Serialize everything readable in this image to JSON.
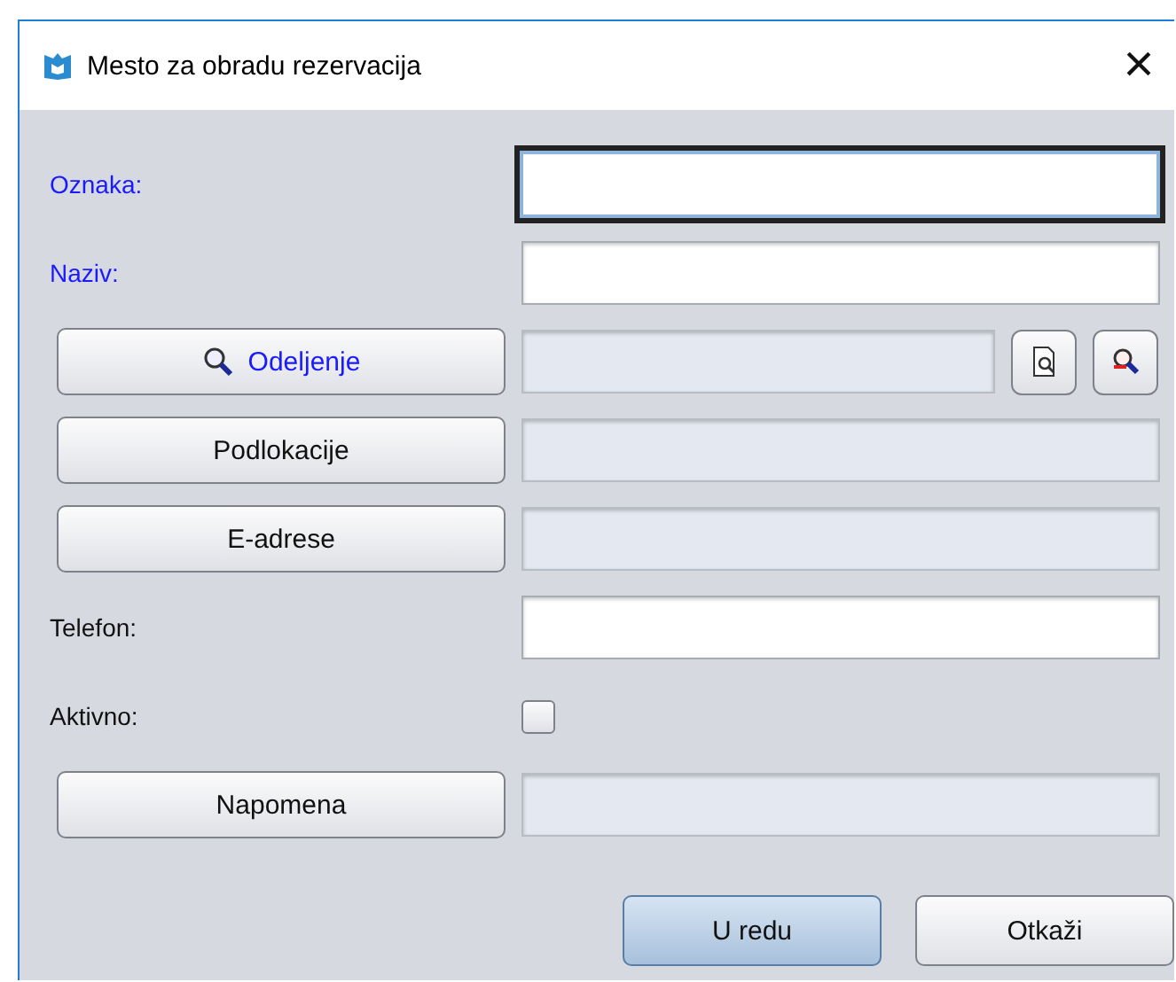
{
  "window": {
    "title": "Mesto za obradu rezervacija",
    "close": "×"
  },
  "rows": [
    {
      "kind": "text",
      "label": "Oznaka:",
      "required": true,
      "editable": true,
      "focused": true
    },
    {
      "kind": "text",
      "label": "Naziv:",
      "required": true,
      "editable": true,
      "focused": false
    },
    {
      "kind": "lookup",
      "label": "Odeljenje",
      "required": true,
      "editable": false,
      "focused": false
    },
    {
      "kind": "button",
      "label": "Podlokacije",
      "required": false,
      "editable": false,
      "focused": false
    },
    {
      "kind": "button",
      "label": "E-adrese",
      "required": false,
      "editable": false,
      "focused": false
    },
    {
      "kind": "text",
      "label": "Telefon:",
      "required": false,
      "editable": true,
      "focused": false
    },
    {
      "kind": "checkbox",
      "label": "Aktivno:",
      "required": false,
      "checked": false
    },
    {
      "kind": "button",
      "label": "Napomena",
      "required": false,
      "editable": false,
      "focused": false
    }
  ],
  "buttons": [
    {
      "label": "U redu",
      "default": true
    },
    {
      "label": "Otkaži",
      "default": false
    }
  ]
}
